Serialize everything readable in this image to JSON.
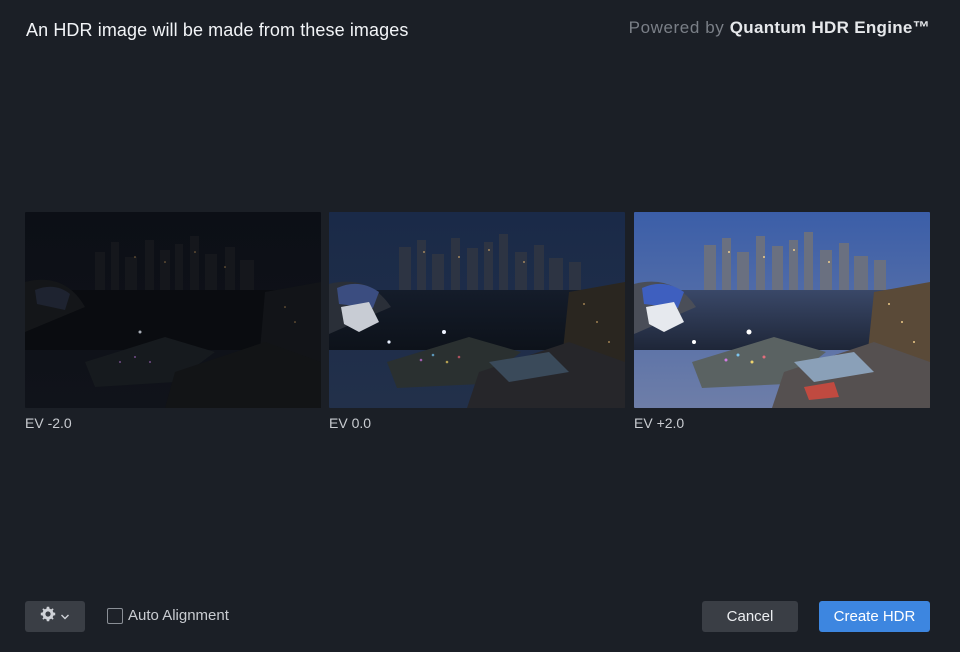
{
  "header": {
    "title": "An HDR image will be made from these images",
    "powered_prefix": "Powered by ",
    "powered_brand": "Quantum HDR Engine™"
  },
  "images": [
    {
      "label": "EV -2.0",
      "exposure": -2.0
    },
    {
      "label": "EV 0.0",
      "exposure": 0.0
    },
    {
      "label": "EV +2.0",
      "exposure": 2.0
    }
  ],
  "footer": {
    "settings_icon": "gear-icon",
    "settings_chevron": "chevron-down-icon",
    "auto_alignment_label": "Auto Alignment",
    "auto_alignment_checked": false,
    "cancel_label": "Cancel",
    "create_label": "Create HDR"
  },
  "colors": {
    "background": "#1b1f26",
    "button": "#3a3e45",
    "primary": "#3d86e0"
  }
}
